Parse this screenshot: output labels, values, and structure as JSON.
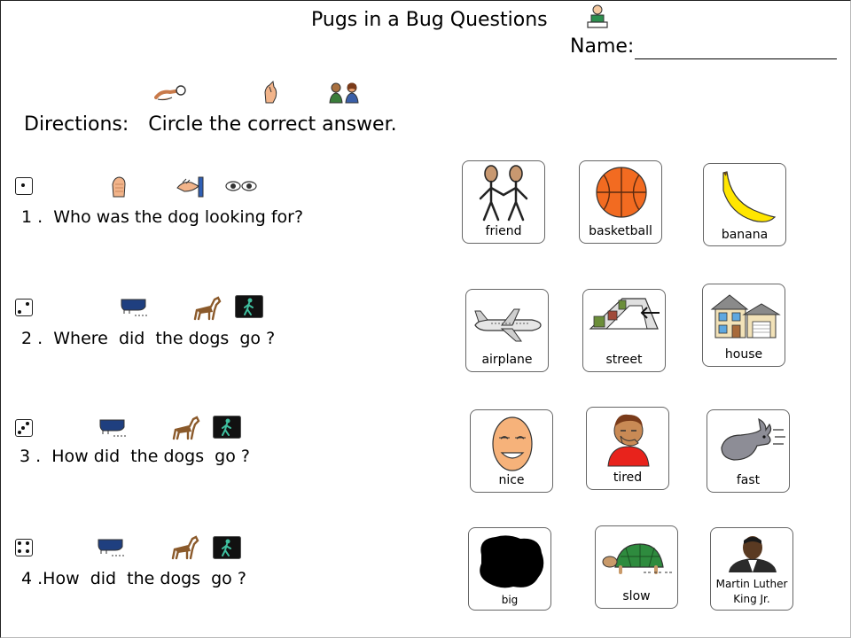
{
  "header": {
    "title": "Pugs in a Bug Questions",
    "name_label": "Name:"
  },
  "directions": {
    "label": "Directions:",
    "text": "Circle the correct answer."
  },
  "questions": [
    {
      "number": "1 .",
      "text": "Who was the dog looking for?",
      "choices": [
        "friend",
        "basketball",
        "banana"
      ]
    },
    {
      "number": "2 .",
      "text": "Where  did  the dogs  go ?",
      "choices": [
        "airplane",
        "street",
        "house"
      ]
    },
    {
      "number": "3 .",
      "text": "How did  the dogs  go ?",
      "choices": [
        "nice",
        "tired",
        "fast"
      ]
    },
    {
      "number": "4 .",
      "text": "How  did  the dogs  go ?",
      "choices": [
        "big",
        "slow",
        "Martin Luther",
        "King Jr."
      ]
    }
  ],
  "icons": {
    "header": "person-at-desk-icon",
    "directions": [
      "pointing-hand-icon",
      "signing-hand-icon",
      "two-people-talking-icon"
    ],
    "q1": [
      "dice-one-icon",
      "hand-who-icon",
      "hand-looking-icon",
      "eyes-icon"
    ],
    "q2_q4": [
      "dice-icon",
      "shoes-walking-icon",
      "dogs-icon",
      "walk-sign-icon"
    ]
  },
  "colors": {
    "basketball": "#f26b21",
    "banana": "#ffe600",
    "turtle": "#2e8b3e",
    "shirt": "#e8231c",
    "walk_sign": "#3fbf9f"
  }
}
